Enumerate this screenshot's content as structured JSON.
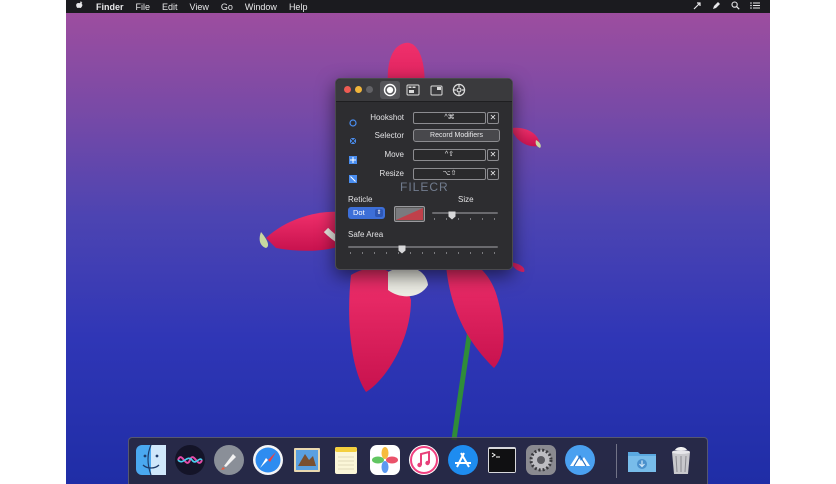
{
  "menubar": {
    "apple": "",
    "app_name": "Finder",
    "items": [
      "File",
      "Edit",
      "View",
      "Go",
      "Window",
      "Help"
    ],
    "status_icons": [
      "cursor-icon",
      "pen-icon",
      "search-icon",
      "list-icon"
    ]
  },
  "window": {
    "tabs": [
      "record-tab-icon",
      "keyboard-tab-icon",
      "window-tab-icon",
      "settings-tab-icon"
    ],
    "selected_tab": "record-tab-icon",
    "shortcuts": [
      {
        "label": "Hookshot",
        "value": "^⌘",
        "clear": "✕"
      },
      {
        "label": "Selector",
        "value": "Record Modifiers"
      },
      {
        "label": "Move",
        "value": "^⇧",
        "clear": "✕"
      },
      {
        "label": "Resize",
        "value": "⌥⇧",
        "clear": "✕"
      }
    ],
    "reticle_label": "Reticle",
    "reticle_value": "Dot",
    "size_label": "Size",
    "safe_area_label": "Safe Area",
    "watermark": "FILECR",
    "size_slider_value": 0.3,
    "safe_area_slider_value": 0.36
  },
  "dock": {
    "apps": [
      "Finder",
      "Siri",
      "Launchpad",
      "Safari",
      "Mail",
      "Notes",
      "Photos",
      "iTunes",
      "App Store",
      "Terminal",
      "System Preferences",
      "Hookshot",
      "Downloads",
      "Trash"
    ]
  },
  "colors": {
    "accent": "#3d6fd8",
    "window_bg": "#2d2d30",
    "reticle_color": "#c0404a"
  }
}
